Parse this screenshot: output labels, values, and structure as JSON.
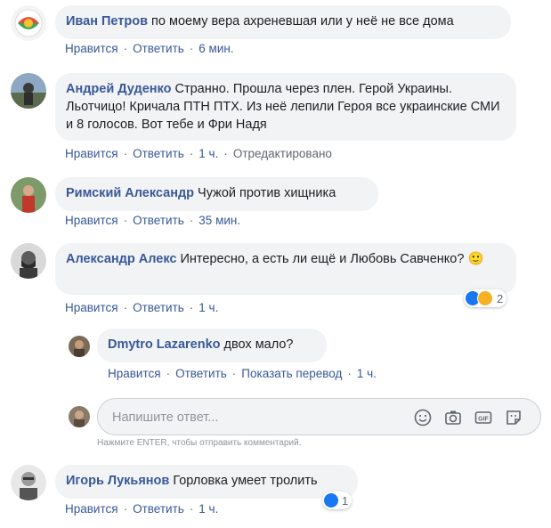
{
  "comments": [
    {
      "author": "Иван Петров",
      "text": "по моему вера ахреневшая или у неё не все дома",
      "actions": {
        "like": "Нравится",
        "reply": "Ответить",
        "time": "6 мин."
      }
    },
    {
      "author": "Андрей Дуденко",
      "text": "Странно. Прошла через плен. Герой Украины. Льотчицо! Кричала ПТН ПТХ. Из неё лепили Героя все украинские СМИ и 8 голосов. Вот тебе и Фри Надя",
      "actions": {
        "like": "Нравится",
        "reply": "Ответить",
        "time": "1 ч.",
        "edited": "Отредактировано"
      }
    },
    {
      "author": "Римский Александр",
      "text": "Чужой против хищника",
      "actions": {
        "like": "Нравится",
        "reply": "Ответить",
        "time": "35 мин."
      }
    },
    {
      "author": "Александр Алекс",
      "text": "Интересно, а есть ли ещё и Любовь Савченко? 🙂",
      "reactions_count": "2",
      "actions": {
        "like": "Нравится",
        "reply": "Ответить",
        "time": "1 ч."
      },
      "replies": [
        {
          "author": "Dmytro Lazarenko",
          "text": "двох мало?",
          "actions": {
            "like": "Нравится",
            "reply": "Ответить",
            "translate": "Показать перевод",
            "time": "1 ч."
          }
        }
      ]
    },
    {
      "author": "Игорь Лукьянов",
      "text": "Горловка умеет тролить",
      "reactions_count": "1",
      "actions": {
        "like": "Нравится",
        "reply": "Ответить",
        "time": "1 ч."
      }
    }
  ],
  "reply_box": {
    "placeholder": "Напишите ответ...",
    "hint": "Нажмите ENTER, чтобы отправить комментарий."
  },
  "colors": {
    "link": "#385898",
    "bubble": "#f2f3f5",
    "meta": "#606770",
    "like": "#1877f2"
  }
}
